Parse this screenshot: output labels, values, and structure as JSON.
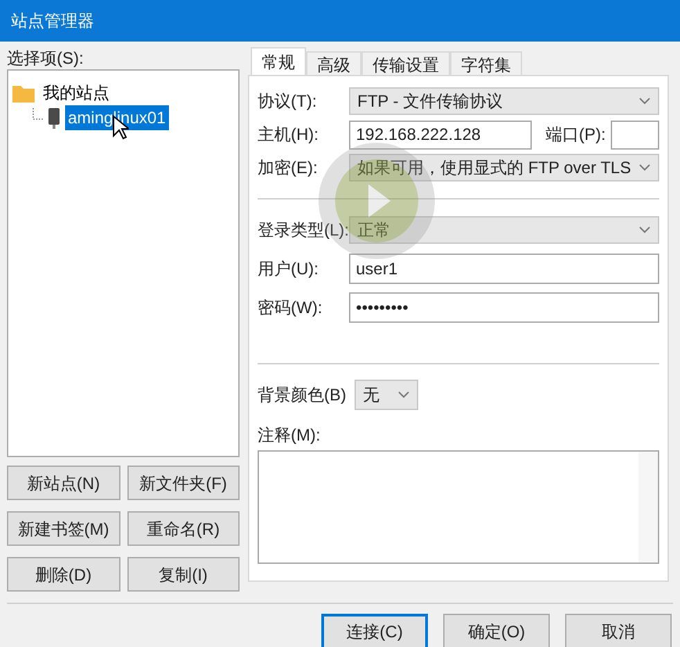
{
  "window": {
    "title": "站点管理器"
  },
  "site_tree": {
    "label": "选择项(S):",
    "items": [
      {
        "label": "我的站点",
        "selected": false,
        "children": [
          {
            "label": "aminglinux01",
            "selected": true
          }
        ]
      }
    ]
  },
  "site_buttons": [
    "新站点(N)",
    "新文件夹(F)",
    "新建书签(M)",
    "重命名(R)",
    "删除(D)",
    "复制(I)"
  ],
  "tabs": [
    {
      "label": "常规",
      "selected": true
    },
    {
      "label": "高级",
      "selected": false
    },
    {
      "label": "传输设置",
      "selected": false
    },
    {
      "label": "字符集",
      "selected": false
    }
  ],
  "general": {
    "protocol": {
      "label": "协议(T):",
      "value": "FTP - 文件传输协议"
    },
    "host": {
      "label": "主机(H):",
      "value": "192.168.222.128"
    },
    "port": {
      "label": "端口(P):"
    },
    "encryption": {
      "label": "加密(E):",
      "value": "如果可用，使用显式的 FTP over TLS"
    },
    "logon_type": {
      "label": "登录类型(L):",
      "value": "正常"
    },
    "user": {
      "label": "用户(U):",
      "value": "user1"
    },
    "password": {
      "label": "密码(W):",
      "value": "•••••••••"
    },
    "background_color": {
      "label": "背景颜色(B)",
      "value": "无"
    },
    "comments": {
      "label": "注释(M):"
    }
  },
  "dialog_buttons": [
    {
      "label": "连接(C)",
      "default": true
    },
    {
      "label": "确定(O)",
      "default": false
    },
    {
      "label": "取消",
      "default": false
    }
  ]
}
